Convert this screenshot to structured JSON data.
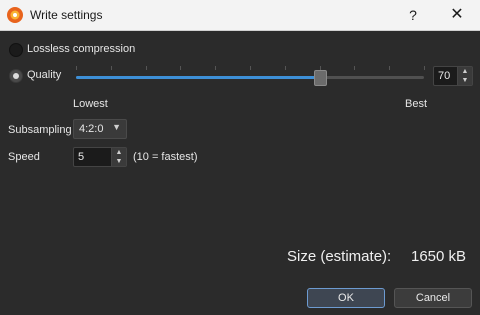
{
  "window": {
    "title": "Write settings",
    "help_symbol": "?",
    "close_symbol": "✕"
  },
  "options": {
    "lossless_label": "Lossless compression",
    "quality_label": "Quality",
    "selected_mode": "Quality"
  },
  "quality": {
    "value": "70",
    "min_label": "Lowest",
    "max_label": "Best",
    "fraction": 0.7
  },
  "subsampling": {
    "label": "Subsampling",
    "value": "4:2:0"
  },
  "speed": {
    "label": "Speed",
    "value": "5",
    "hint": "(10 = fastest)"
  },
  "size": {
    "label": "Size (estimate):",
    "value": "1650 kB"
  },
  "buttons": {
    "ok": "OK",
    "cancel": "Cancel"
  },
  "icons": {
    "app": "xnview-icon",
    "spin_up": "▲",
    "spin_down": "▼",
    "dropdown": "▼"
  },
  "colors": {
    "accent": "#3d8fd6",
    "background": "#2b2b2b"
  }
}
